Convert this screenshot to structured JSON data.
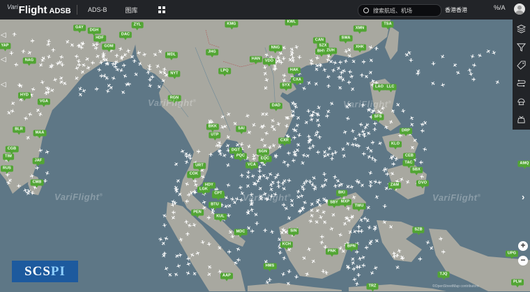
{
  "brand": {
    "prefix": "Vari",
    "name": "Flight",
    "suffix": "ADSB"
  },
  "nav": {
    "mode": "ADS-B",
    "gallery": "图库"
  },
  "search": {
    "placeholder": "搜索航班、机场"
  },
  "header": {
    "region": "香港香港",
    "unit_toggle": "%/A"
  },
  "watermark": {
    "text": "VariFlight",
    "mark": "®"
  },
  "footer": {
    "logo_a": "SCS",
    "logo_b": "PI",
    "attribution": "©OpenStreetMap contributors"
  },
  "zoom": {
    "in": "+",
    "out": "−"
  },
  "colors": {
    "sea": "#5e7786",
    "land": "#a8a8a0",
    "airport": "#52a534",
    "topbar": "#222428",
    "plane": "#ffffff"
  },
  "toolbar_icons": [
    "layers-icon",
    "filter-icon",
    "tag-icon",
    "route-icon",
    "radar-icon",
    "vehicle-icon"
  ],
  "airports": [
    "GAY",
    "DGH",
    "HDF",
    "GOM",
    "DAC",
    "ZYL",
    "KMG",
    "KWL",
    "CAN",
    "SWA",
    "XMN",
    "TSA",
    "NAG",
    "MDL",
    "JHG",
    "NNG",
    "SZX",
    "XHK",
    "BHY",
    "ZUH",
    "HYD",
    "VGA",
    "NYT",
    "HAN",
    "VDO",
    "HAK",
    "LPQ",
    "LAO",
    "LLC",
    "RGN",
    "CXA",
    "SYX",
    "DAD",
    "SFS",
    "DRP",
    "BLR",
    "MAA",
    "BKK",
    "SAI",
    "UTP",
    "CXR",
    "KLO",
    "CEB",
    "TAC",
    "CMB",
    "JAF",
    "CGB",
    "URT",
    "HKT",
    "SGN",
    "PQC",
    "VCA",
    "DGT",
    "ZAM",
    "DVO",
    "HDY",
    "LGK",
    "KBV",
    "BTU",
    "BKI",
    "TWU",
    "PEN",
    "KUL",
    "SZB",
    "MDC",
    "SIN",
    "KCH",
    "PNK",
    "BPN",
    "HMS",
    "AAP",
    "TJQ",
    "PLM",
    "UPG",
    "AMQ",
    "TIM",
    "RUS",
    "CPT",
    "MXP",
    "COK",
    "TRZ",
    "SBY",
    "YAP",
    "SBX",
    "OAG",
    "DSS",
    "EQC"
  ]
}
